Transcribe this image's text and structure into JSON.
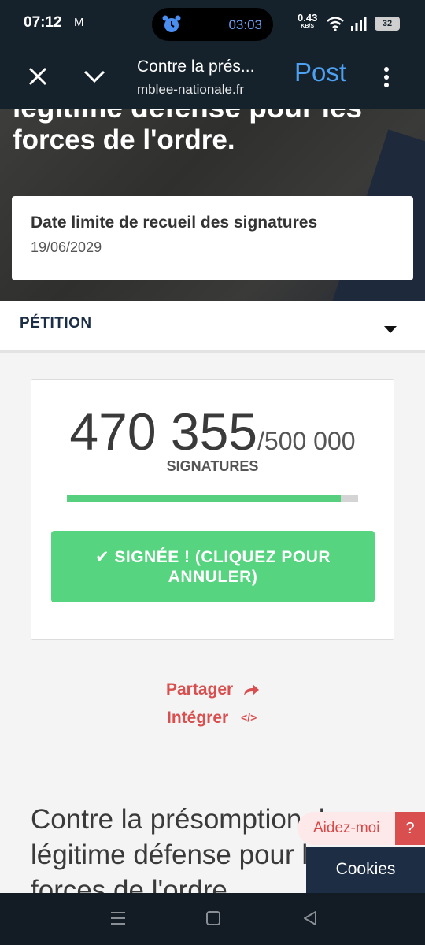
{
  "status_bar": {
    "time": "07:12",
    "mail_icon": "M",
    "timer": "03:03",
    "net_speed": "0.43",
    "net_unit": "KB/S",
    "battery": "32"
  },
  "toolbar": {
    "tab_title": "Contre la prés...",
    "url": "mblee-nationale.fr",
    "post_label": "Post"
  },
  "hero": {
    "title_partial": "légitime défense pour les",
    "title_line": "forces de l'ordre."
  },
  "deadline": {
    "label": "Date limite de recueil des signatures",
    "value": "19/06/2029"
  },
  "petition_section": {
    "label": "PÉTITION"
  },
  "signatures": {
    "count": "470 355",
    "goal": "/500 000",
    "label": "SIGNATURES",
    "progress_percent": 94,
    "button_line1": "✔ SIGNÉE ! (CLIQUEZ POUR",
    "button_line2": "ANNULER)"
  },
  "links": {
    "share": "Partager",
    "embed": "Intégrer",
    "embed_icon": "</>"
  },
  "body_title": "Contre la présomption de légitime défense pour les forces de l'ordre.",
  "help": {
    "label": "Aidez-moi",
    "question_mark": "?"
  },
  "cookies": {
    "label": "Cookies"
  },
  "colors": {
    "toolbar_bg": "#15222c",
    "post_blue": "#4ea1f2",
    "green": "#56d47f",
    "red": "#d94e4e",
    "navy": "#1c2e45"
  }
}
